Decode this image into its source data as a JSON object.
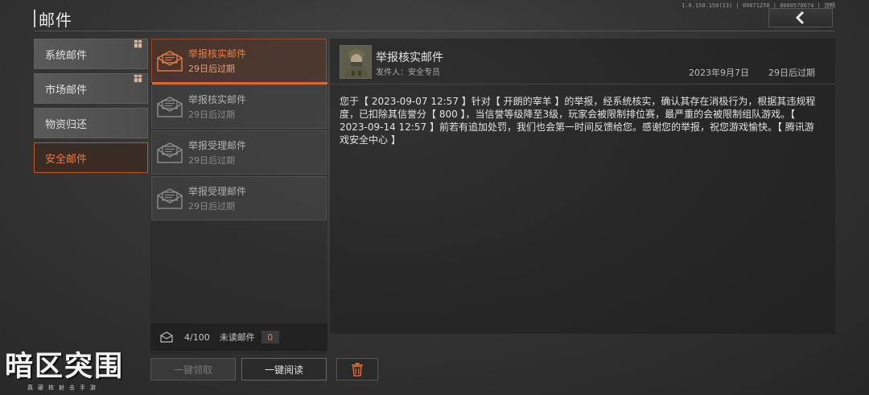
{
  "header": {
    "title": "邮件",
    "version": "1.0.150.150(13) | 09071258 | 8000578674 | 流畅"
  },
  "sidebar": {
    "items": [
      {
        "label": "系统邮件",
        "has_gift": true
      },
      {
        "label": "市场邮件",
        "has_gift": true
      },
      {
        "label": "物资归还",
        "has_gift": false
      },
      {
        "label": "安全邮件",
        "has_gift": false,
        "active": true
      }
    ]
  },
  "mail_list": {
    "items": [
      {
        "title": "举报核实邮件",
        "expires": "29日后过期",
        "active": true
      },
      {
        "title": "举报核实邮件",
        "expires": "29日后过期",
        "active": false
      },
      {
        "title": "举报受理邮件",
        "expires": "29日后过期",
        "active": false
      },
      {
        "title": "举报受理邮件",
        "expires": "29日后过期",
        "active": false
      }
    ],
    "footer": {
      "count": "4/100",
      "unread_label": "未读邮件",
      "unread_count": "0"
    }
  },
  "buttons": {
    "claim_all": "一键领取",
    "read_all": "一键阅读"
  },
  "message": {
    "title": "举报核实邮件",
    "sender": "发件人：安全专员",
    "date": "2023年9月7日",
    "expires": "29日后过期",
    "body": "您于【 2023-09-07 12:57 】针对【 开朗的宰羊 】的举报，经系统核实，确认其存在消极行为，根据其违规程度，已扣除其信誉分【 800 】，当信誉等级降至3级，玩家会被限制排位赛，最严重的会被限制组队游戏。【 2023-09-14 12:57 】前若有追加处罚，我们也会第一时间反馈给您。感谢您的举报，祝您游戏愉快。【 腾讯游戏安全中心 】"
  },
  "logo": {
    "text": "暗区突围",
    "subtitle": "真硬核射击手游"
  },
  "colors": {
    "accent": "#f07a40",
    "accent_border": "#c0562a"
  }
}
